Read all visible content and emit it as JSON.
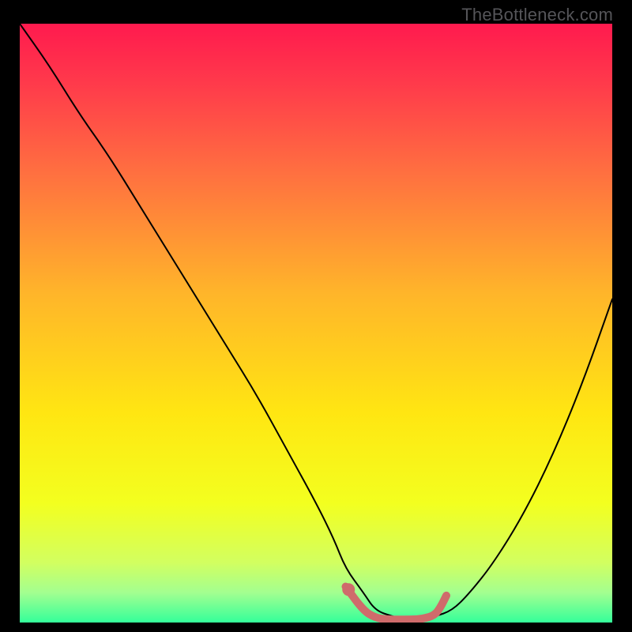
{
  "watermark": "TheBottleneck.com",
  "chart_data": {
    "type": "line",
    "title": "",
    "xlabel": "",
    "ylabel": "",
    "xlim": [
      0,
      100
    ],
    "ylim": [
      0,
      100
    ],
    "grid": false,
    "legend": false,
    "background_gradient": {
      "stops": [
        {
          "pos": 0.0,
          "color": "#ff1a4e"
        },
        {
          "pos": 0.1,
          "color": "#ff3a4b"
        },
        {
          "pos": 0.25,
          "color": "#ff7040"
        },
        {
          "pos": 0.45,
          "color": "#ffb52a"
        },
        {
          "pos": 0.65,
          "color": "#ffe612"
        },
        {
          "pos": 0.8,
          "color": "#f3ff1f"
        },
        {
          "pos": 0.9,
          "color": "#d2ff60"
        },
        {
          "pos": 0.95,
          "color": "#a3ff90"
        },
        {
          "pos": 1.0,
          "color": "#34ff9a"
        }
      ]
    },
    "series": [
      {
        "name": "curve",
        "color": "#000000",
        "width": 2,
        "x": [
          0,
          5,
          10,
          15,
          20,
          25,
          30,
          35,
          40,
          45,
          50,
          53,
          55,
          58,
          60,
          63,
          65,
          68,
          70,
          73,
          76,
          80,
          85,
          90,
          95,
          100
        ],
        "y": [
          100,
          93,
          85,
          78,
          70,
          62,
          54,
          46,
          38,
          29,
          20,
          14,
          9,
          5,
          2,
          1,
          0.5,
          0.5,
          1,
          2,
          5,
          10,
          18,
          28,
          40,
          54
        ]
      },
      {
        "name": "optimal-zone-highlight",
        "color": "#cf6b6b",
        "width": 10,
        "x": [
          55,
          58,
          60,
          62,
          64,
          66,
          68,
          70,
          71,
          72
        ],
        "y": [
          6,
          2,
          0.8,
          0.5,
          0.5,
          0.5,
          0.6,
          1.2,
          2.5,
          4.5
        ]
      },
      {
        "name": "optimal-point-dot",
        "color": "#cf6b6b",
        "type": "point",
        "radius": 8,
        "x": [
          55.5
        ],
        "y": [
          5.5
        ]
      }
    ]
  }
}
